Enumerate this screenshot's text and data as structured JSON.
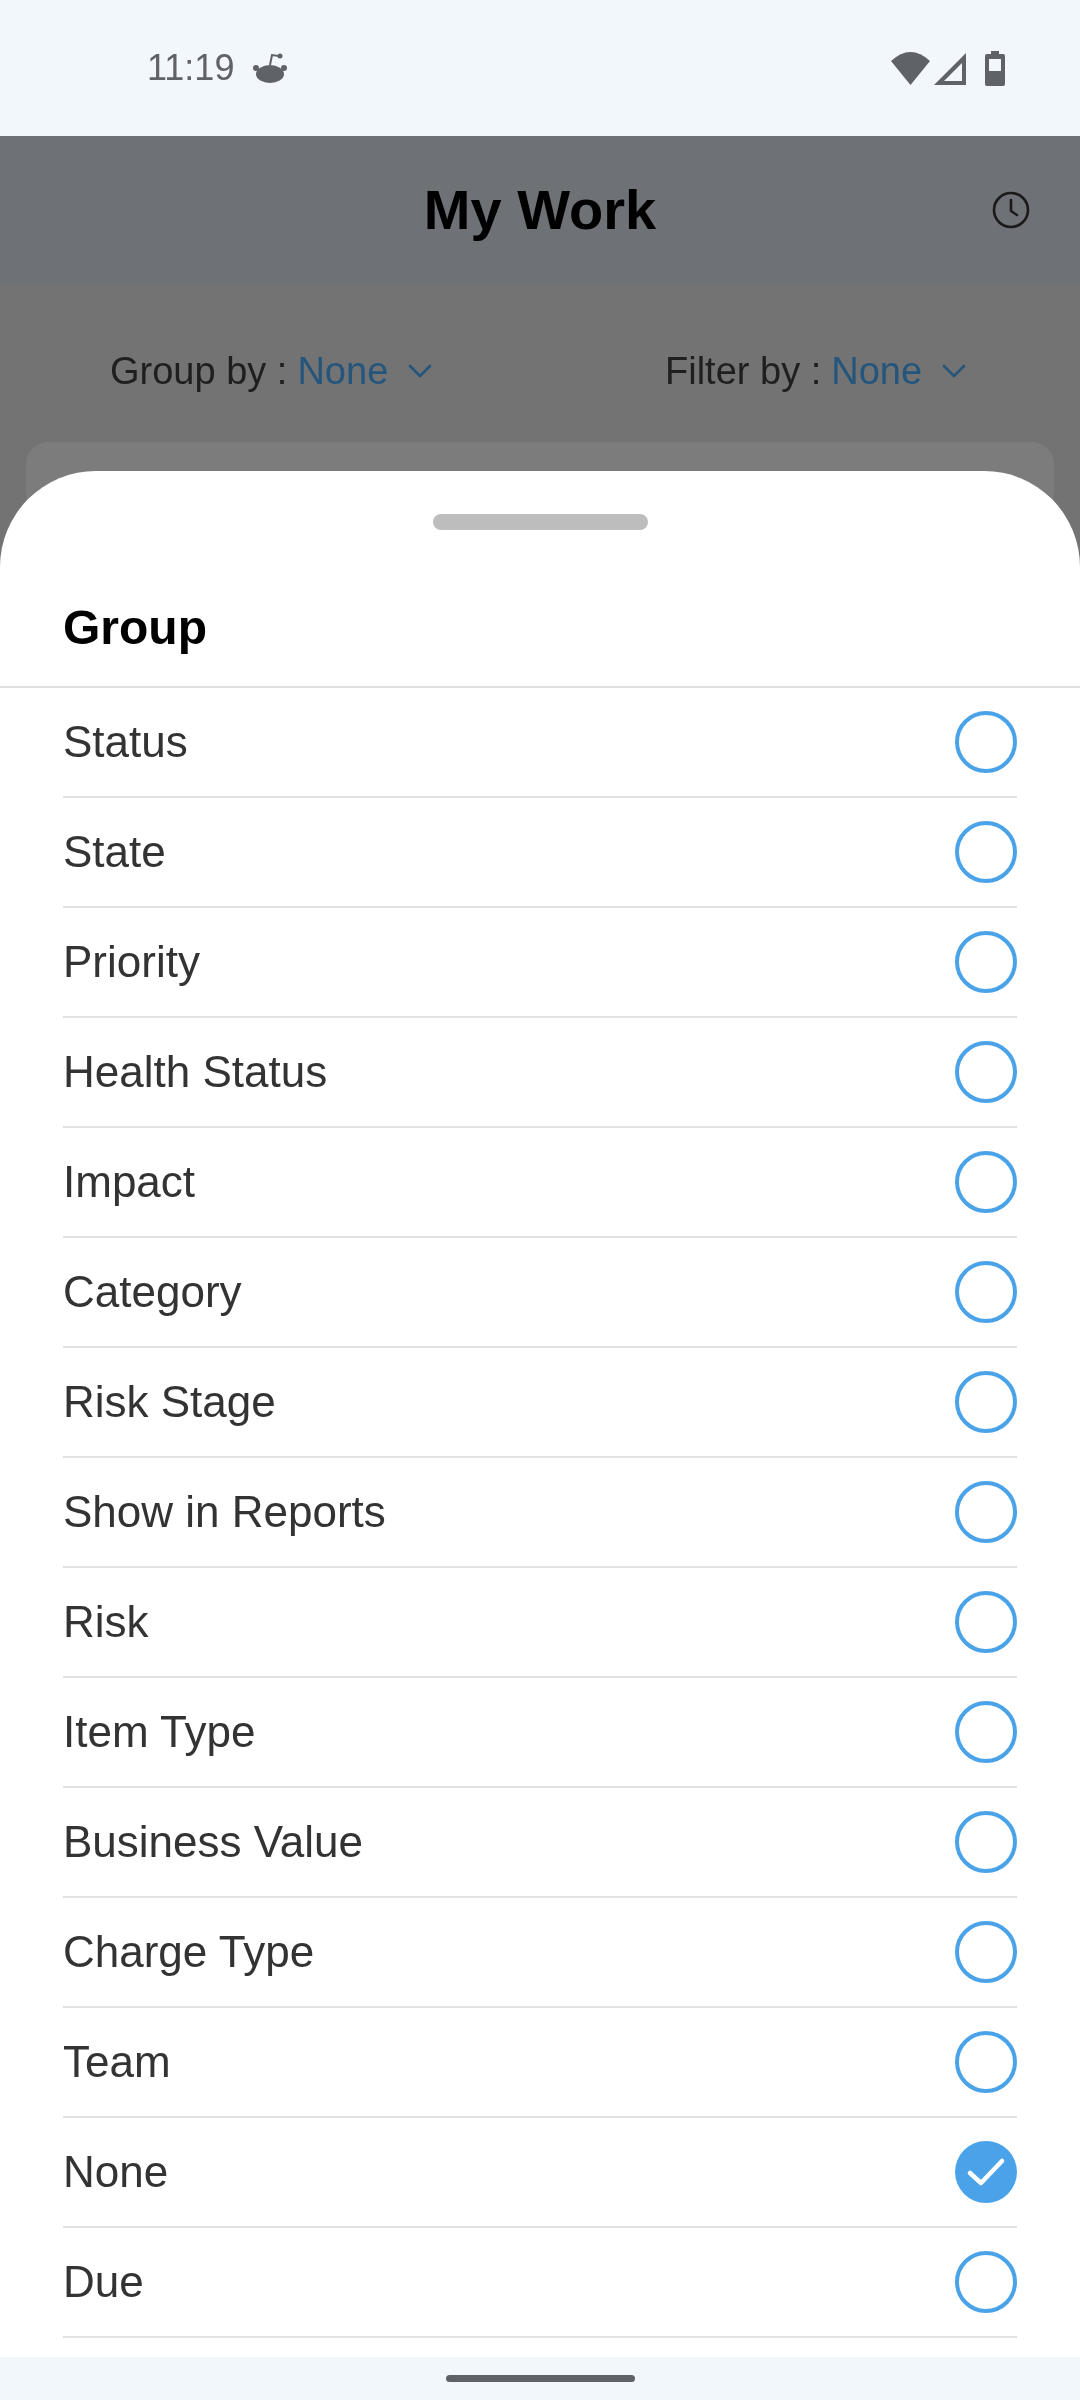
{
  "status_bar": {
    "time": "11:19"
  },
  "header": {
    "title": "My Work"
  },
  "filters": [
    {
      "label": "Group by :",
      "value": "None"
    },
    {
      "label": "Filter by :",
      "value": "None"
    }
  ],
  "sheet": {
    "title": "Group",
    "options": [
      {
        "label": "Status",
        "selected": false
      },
      {
        "label": "State",
        "selected": false
      },
      {
        "label": "Priority",
        "selected": false
      },
      {
        "label": "Health Status",
        "selected": false
      },
      {
        "label": "Impact",
        "selected": false
      },
      {
        "label": "Category",
        "selected": false
      },
      {
        "label": "Risk Stage",
        "selected": false
      },
      {
        "label": "Show in Reports",
        "selected": false
      },
      {
        "label": "Risk",
        "selected": false
      },
      {
        "label": "Item Type",
        "selected": false
      },
      {
        "label": "Business Value",
        "selected": false
      },
      {
        "label": "Charge Type",
        "selected": false
      },
      {
        "label": "Team",
        "selected": false
      },
      {
        "label": "None",
        "selected": true
      },
      {
        "label": "Due",
        "selected": false
      }
    ]
  }
}
